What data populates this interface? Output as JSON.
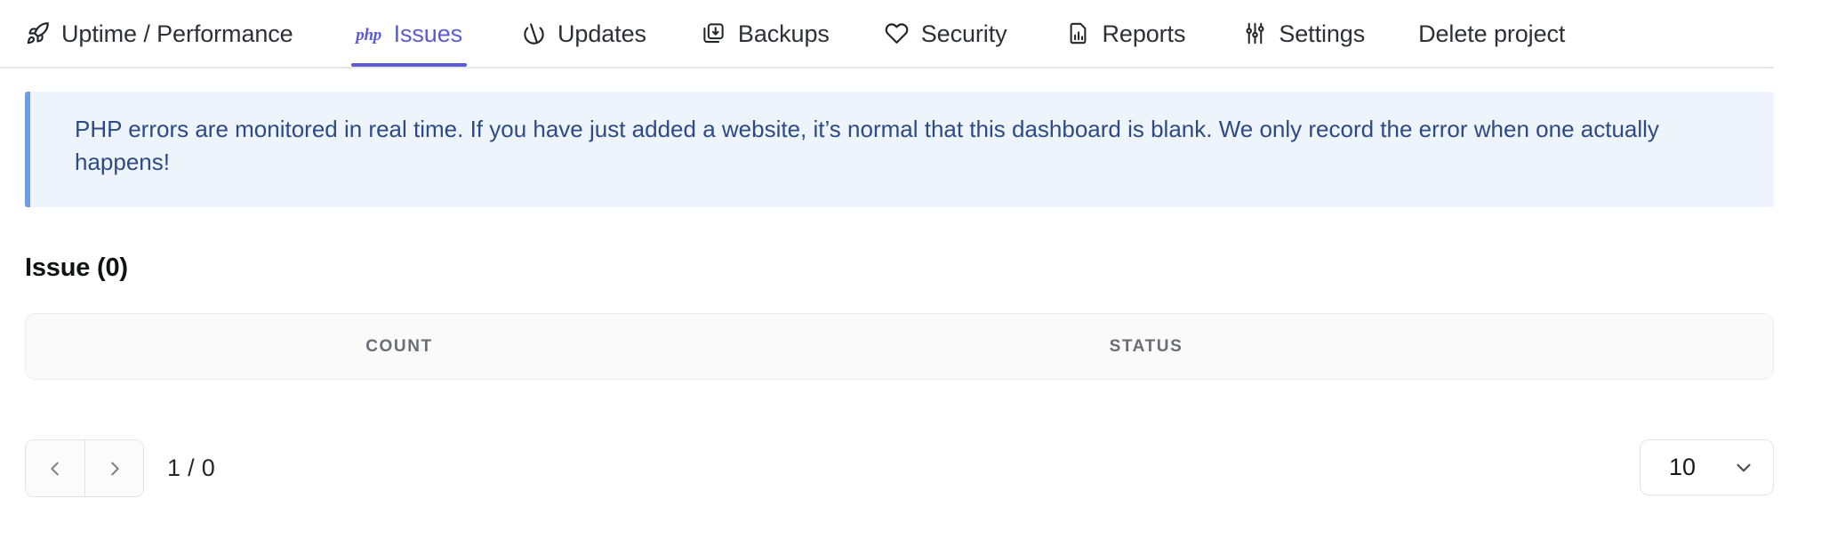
{
  "nav": {
    "tabs": [
      {
        "label": "Uptime / Performance",
        "icon": "rocket-icon",
        "active": false
      },
      {
        "label": "Issues",
        "icon": "php-icon",
        "active": true
      },
      {
        "label": "Updates",
        "icon": "plug-icon",
        "active": false
      },
      {
        "label": "Backups",
        "icon": "backup-download-icon",
        "active": false
      },
      {
        "label": "Security",
        "icon": "heart-icon",
        "active": false
      },
      {
        "label": "Reports",
        "icon": "report-document-icon",
        "active": false
      },
      {
        "label": "Settings",
        "icon": "sliders-icon",
        "active": false
      },
      {
        "label": "Delete project",
        "icon": "",
        "active": false
      }
    ],
    "php_mark": "php",
    "active_color": "#5b5bd6"
  },
  "alert": {
    "message": "PHP errors are monitored in real time. If you have just added a website, it’s normal that this dashboard is blank. We only record the error when one actually happens!",
    "background_color": "#eef4fc",
    "border_color": "#6d9ce8",
    "text_color": "#2d4a86"
  },
  "section": {
    "title": "Issue (0)"
  },
  "table": {
    "columns": [
      "COUNT",
      "STATUS"
    ],
    "rows": []
  },
  "pagination": {
    "prev_label": "‹",
    "next_label": "›",
    "page_indicator": "1 / 0",
    "page_size_value": "10"
  }
}
